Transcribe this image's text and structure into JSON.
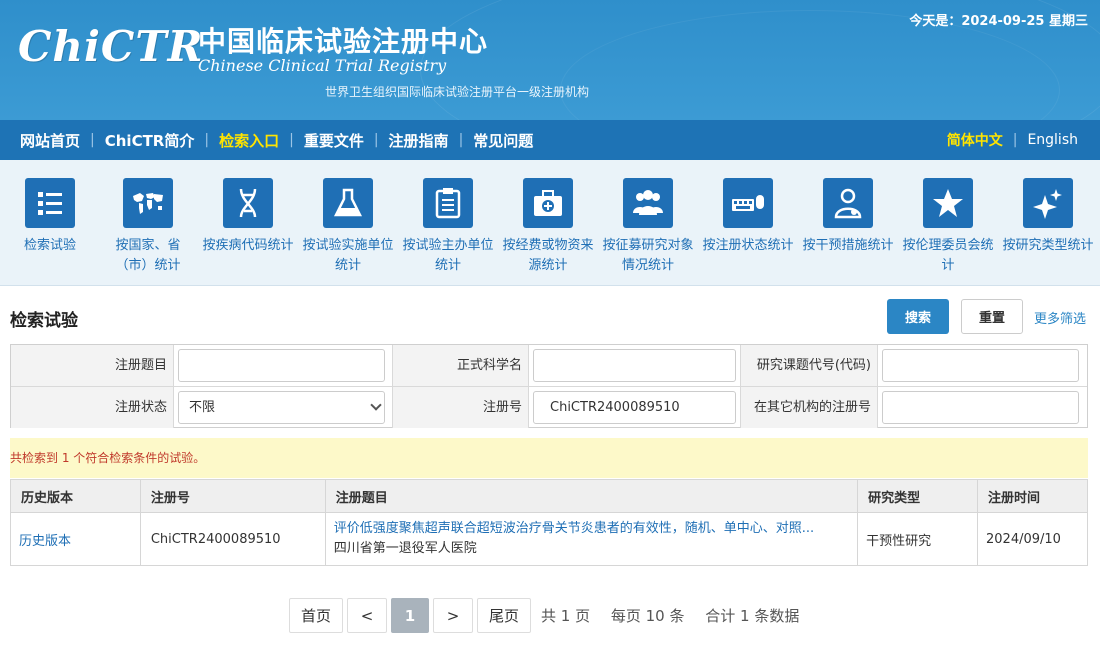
{
  "header": {
    "logo": "ChiCTR",
    "title_cn": "中国临床试验注册中心",
    "title_en": "Chinese Clinical Trial Registry",
    "subtitle": "世界卫生组织国际临床试验注册平台一级注册机构",
    "today": "今天是：2024-09-25 星期三"
  },
  "nav": {
    "items": [
      {
        "label": "网站首页",
        "active": false
      },
      {
        "label": "ChiCTR简介",
        "active": false
      },
      {
        "label": "检索入口",
        "active": true
      },
      {
        "label": "重要文件",
        "active": false
      },
      {
        "label": "注册指南",
        "active": false
      },
      {
        "label": "常见问题",
        "active": false
      }
    ],
    "lang_cn": "简体中文",
    "lang_en": "English"
  },
  "tiles": [
    {
      "label": "检索试验",
      "icon": "list-icon"
    },
    {
      "label": "按国家、省（市）统计",
      "icon": "world-map-icon"
    },
    {
      "label": "按疾病代码统计",
      "icon": "dna-icon"
    },
    {
      "label": "按试验实施单位统计",
      "icon": "flask-icon"
    },
    {
      "label": "按试验主办单位统计",
      "icon": "clipboard-icon"
    },
    {
      "label": "按经费或物资来源统计",
      "icon": "medical-kit-icon"
    },
    {
      "label": "按征募研究对象情况统计",
      "icon": "people-icon"
    },
    {
      "label": "按注册状态统计",
      "icon": "keyboard-mouse-icon"
    },
    {
      "label": "按干预措施统计",
      "icon": "doctor-icon"
    },
    {
      "label": "按伦理委员会统计",
      "icon": "star-icon"
    },
    {
      "label": "按研究类型统计",
      "icon": "sparkle-icon"
    }
  ],
  "search": {
    "title": "检索试验",
    "search_btn": "搜索",
    "reset_btn": "重置",
    "more": "更多筛选",
    "labels": {
      "reg_title": "注册题目",
      "sci_name": "正式科学名",
      "project_code": "研究课题代号(代码)",
      "reg_status": "注册状态",
      "reg_no": "注册号",
      "other_reg_no": "在其它机构的注册号"
    },
    "values": {
      "reg_title": "",
      "sci_name": "",
      "project_code": "",
      "reg_status": "不限",
      "reg_no": "ChiCTR2400089510",
      "other_reg_no": ""
    }
  },
  "result_notice": "共检索到 1 个符合检索条件的试验。",
  "table": {
    "headers": [
      "历史版本",
      "注册号",
      "注册题目",
      "研究类型",
      "注册时间"
    ],
    "rows": [
      {
        "history": "历史版本",
        "reg_no": "ChiCTR2400089510",
        "title": "评价低强度聚焦超声联合超短波治疗骨关节炎患者的有效性，随机、单中心、对照...",
        "org": "四川省第一退役军人医院",
        "type": "干预性研究",
        "date": "2024/09/10"
      }
    ]
  },
  "pager": {
    "first": "首页",
    "prev": "<",
    "current": "1",
    "next": ">",
    "last": "尾页",
    "total_pages": "共 1 页",
    "per_page": "每页 10 条",
    "total": "合计 1 条数据"
  }
}
